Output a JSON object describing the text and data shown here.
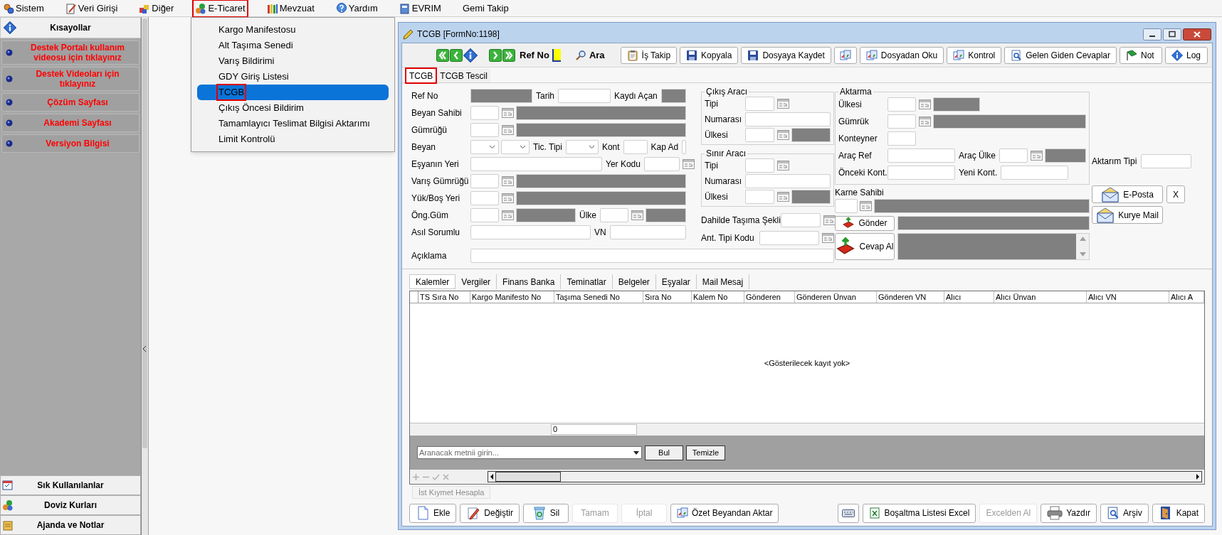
{
  "menu_bar": [
    {
      "label": "Sistem",
      "selected": false
    },
    {
      "label": "Veri Girişi",
      "selected": false
    },
    {
      "label": "Diğer",
      "selected": false
    },
    {
      "label": "E-Ticaret",
      "selected": true
    },
    {
      "label": "Mevzuat",
      "selected": false
    },
    {
      "label": "Yardım",
      "selected": false
    },
    {
      "label": "EVRIM",
      "selected": false
    },
    {
      "label": "Gemi Takip",
      "selected": false
    }
  ],
  "menu_dropdown": [
    {
      "label": "Kargo Manifestosu",
      "selected": false
    },
    {
      "label": "Alt Taşıma Senedi",
      "selected": false
    },
    {
      "label": "Varış Bildirimi",
      "selected": false
    },
    {
      "label": "GDY Giriş Listesi",
      "selected": false
    },
    {
      "label": "TCGB",
      "selected": true
    },
    {
      "label": "Çıkış Öncesi Bildirim",
      "selected": false
    },
    {
      "label": "Tamamlayıcı Teslimat Bilgisi Aktarımı",
      "selected": false
    },
    {
      "label": "Limit Kontrolü",
      "selected": false
    }
  ],
  "sidebar": {
    "title": "Kısayollar",
    "links": [
      "Destek Portalı kullanım videosu için tıklayınız",
      "Destek Videoları için tıklayınız",
      "Çözüm Sayfası",
      "Akademi Sayfası",
      "Versiyon Bilgisi"
    ],
    "sections": [
      "Sık Kullanılanlar",
      "Doviz Kurları",
      "Ajanda ve Notlar"
    ]
  },
  "window": {
    "title": "TCGB [FormNo:1198]"
  },
  "toolbar": {
    "ref_label": "Ref No",
    "search_button": "Ara",
    "buttons": [
      {
        "kind": "labeled",
        "label": "İş Takip"
      },
      {
        "kind": "labeled",
        "label": "Kopyala"
      },
      {
        "kind": "labeled",
        "label": "Dosyaya Kaydet"
      },
      {
        "kind": "icon_only"
      },
      {
        "kind": "labeled",
        "label": "Dosyadan Oku"
      },
      {
        "kind": "labeled",
        "label": "Kontrol"
      },
      {
        "kind": "labeled",
        "label": "Gelen Giden Cevaplar"
      },
      {
        "kind": "labeled",
        "label": "Not"
      },
      {
        "kind": "labeled",
        "label": "Log"
      }
    ]
  },
  "tabs": [
    {
      "label": "TCGB",
      "selected": true
    },
    {
      "label": "TCGB Tescil",
      "selected": false
    }
  ],
  "form": {
    "left_rows": [
      {
        "label": "Ref No",
        "items": [
          {
            "kind": "display"
          },
          {
            "kind": "label",
            "text": "Tarih"
          },
          {
            "kind": "input"
          },
          {
            "kind": "label",
            "text": "Kaydı Açan"
          },
          {
            "kind": "display"
          }
        ]
      },
      {
        "label": "Beyan Sahibi",
        "items": [
          {
            "kind": "lookup"
          },
          {
            "kind": "display"
          }
        ]
      },
      {
        "label": "Gümrüğü",
        "items": [
          {
            "kind": "lookup"
          },
          {
            "kind": "display"
          }
        ]
      },
      {
        "label": "Beyan",
        "items": [
          {
            "kind": "select"
          },
          {
            "kind": "select"
          },
          {
            "kind": "label",
            "text": "Tic. Tipi"
          },
          {
            "kind": "select"
          },
          {
            "kind": "label",
            "text": "Kont"
          },
          {
            "kind": "input"
          },
          {
            "kind": "label",
            "text": "Kap Ad"
          },
          {
            "kind": "input"
          }
        ]
      },
      {
        "label": "Eşyanın Yeri",
        "items": [
          {
            "kind": "input"
          },
          {
            "kind": "label",
            "text": "Yer Kodu"
          },
          {
            "kind": "lookup"
          }
        ]
      },
      {
        "label": "Varış Gümrüğü",
        "items": [
          {
            "kind": "lookup"
          },
          {
            "kind": "display"
          }
        ]
      },
      {
        "label": "Yük/Boş Yeri",
        "items": [
          {
            "kind": "lookup"
          },
          {
            "kind": "display"
          }
        ]
      },
      {
        "label": "Öng.Güm",
        "items": [
          {
            "kind": "lookup"
          },
          {
            "kind": "display"
          },
          {
            "kind": "label",
            "text": "Ülke"
          },
          {
            "kind": "lookup"
          },
          {
            "kind": "display"
          }
        ]
      },
      {
        "label": "Asıl Sorumlu",
        "items": [
          {
            "kind": "input"
          },
          {
            "kind": "label",
            "text": "VN"
          },
          {
            "kind": "input"
          }
        ]
      }
    ],
    "aciklama": {
      "label": "Açıklama"
    },
    "groups": [
      {
        "title": "Çıkış Aracı",
        "rows": [
          {
            "label": "Tipi",
            "items": [
              {
                "kind": "lookup"
              }
            ]
          },
          {
            "label": "Numarası",
            "items": [
              {
                "kind": "input"
              }
            ]
          },
          {
            "label": "Ülkesi",
            "items": [
              {
                "kind": "lookup"
              },
              {
                "kind": "display"
              }
            ]
          }
        ]
      },
      {
        "title": "Sınır Aracı",
        "rows": [
          {
            "label": "Tipi",
            "items": [
              {
                "kind": "lookup"
              }
            ]
          },
          {
            "label": "Numarası",
            "items": [
              {
                "kind": "input"
              }
            ]
          },
          {
            "label": "Ülkesi",
            "items": [
              {
                "kind": "lookup"
              },
              {
                "kind": "display"
              }
            ]
          }
        ]
      }
    ],
    "transport_rows": [
      {
        "label": "Dahilde Taşıma Şekli",
        "items": [
          {
            "kind": "lookup"
          }
        ]
      },
      {
        "label": "Ant. Tipi Kodu",
        "items": [
          {
            "kind": "lookup"
          }
        ]
      }
    ],
    "aktarma": {
      "title": "Aktarma",
      "rows": [
        {
          "label": "Ülkesi",
          "items": [
            {
              "kind": "lookup"
            },
            {
              "kind": "display"
            }
          ]
        },
        {
          "label": "Gümrük",
          "items": [
            {
              "kind": "lookup"
            },
            {
              "kind": "display"
            }
          ]
        },
        {
          "label": "Konteyner",
          "items": [
            {
              "kind": "input"
            }
          ]
        },
        {
          "label": "Araç Ref",
          "items": [
            {
              "kind": "input"
            },
            {
              "kind": "label",
              "text": "Araç Ülke"
            },
            {
              "kind": "lookup"
            },
            {
              "kind": "display"
            }
          ]
        },
        {
          "label": "Önceki Kont.",
          "items": [
            {
              "kind": "input"
            },
            {
              "kind": "label",
              "text": "Yeni Kont."
            },
            {
              "kind": "input"
            }
          ]
        }
      ]
    },
    "karne_sahibi": "Karne Sahibi",
    "send_button": "Gönder",
    "receive_button": "Cevap Al",
    "aktarim_tipi": "Aktarım Tipi",
    "email_button": "E-Posta",
    "remove_button": "X",
    "courier_button": "Kurye Mail"
  },
  "detail_tabs": [
    {
      "label": "Kalemler",
      "selected": true
    },
    {
      "label": "Vergiler",
      "selected": false
    },
    {
      "label": "Finans Banka",
      "selected": false
    },
    {
      "label": "Teminatlar",
      "selected": false
    },
    {
      "label": "Belgeler",
      "selected": false
    },
    {
      "label": "Eşyalar",
      "selected": false
    },
    {
      "label": "Mail Mesaj",
      "selected": false
    }
  ],
  "grid": {
    "columns": [
      "TS Sıra No",
      "Kargo Manifesto No",
      "Taşıma Senedi No",
      "Sıra No",
      "Kalem No",
      "Gönderen",
      "Gönderen Ünvan",
      "Gönderen VN",
      "Alıcı",
      "Alıcı Ünvan",
      "Alıcı VN",
      "Alıcı A"
    ],
    "empty_text": "<Gösterilecek kayıt yok>",
    "summary": "0"
  },
  "search": {
    "placeholder": "Aranacak metnii girin...",
    "find_button": "Bul",
    "clear_button": "Temizle"
  },
  "value_button": {
    "label": "İst Kıymet Hesapla",
    "disabled": true
  },
  "bottom_buttons": [
    {
      "kind": "labeled",
      "label": "Ekle",
      "disabled": false
    },
    {
      "kind": "labeled",
      "label": "Değiştir",
      "disabled": false
    },
    {
      "kind": "labeled",
      "label": "Sil",
      "disabled": false
    },
    {
      "kind": "labeled",
      "label": "Tamam",
      "disabled": true
    },
    {
      "kind": "labeled",
      "label": "İptal",
      "disabled": true
    },
    {
      "kind": "labeled",
      "label": "Özet Beyandan Aktar",
      "disabled": false
    },
    {
      "kind": "icon_only",
      "disabled": false
    },
    {
      "kind": "labeled",
      "label": "Boşaltma Listesi Excel",
      "disabled": false
    },
    {
      "kind": "labeled",
      "label": "Excelden Al",
      "disabled": true
    },
    {
      "kind": "labeled",
      "label": "Yazdır",
      "disabled": false
    },
    {
      "kind": "labeled",
      "label": "Arşiv",
      "disabled": false
    },
    {
      "kind": "labeled",
      "label": "Kapat",
      "disabled": false
    }
  ]
}
